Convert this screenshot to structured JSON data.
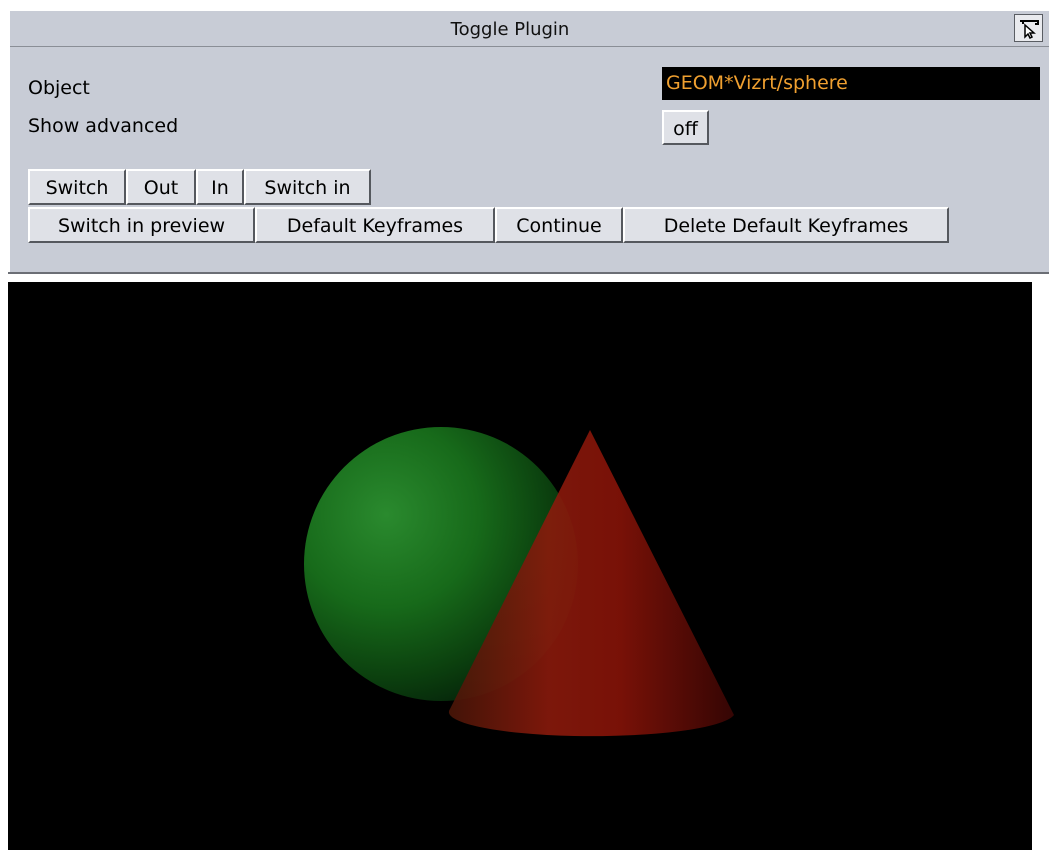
{
  "panel": {
    "title": "Toggle Plugin",
    "help_icon": "help-cursor-icon",
    "properties": {
      "object_label": "Object",
      "object_value": "GEOM*Vizrt/sphere",
      "show_advanced_label": "Show advanced",
      "show_advanced_value": "off"
    },
    "button_row_1": [
      "Switch",
      "Out",
      "In",
      "Switch in"
    ],
    "button_row_2": [
      "Switch in preview",
      "Default Keyframes",
      "Continue",
      "Delete Default Keyframes"
    ]
  },
  "viewport": {
    "background": "#000000",
    "objects": [
      {
        "name": "sphere",
        "color": "#1e7a24"
      },
      {
        "name": "cone",
        "color": "#8a1208"
      }
    ]
  }
}
